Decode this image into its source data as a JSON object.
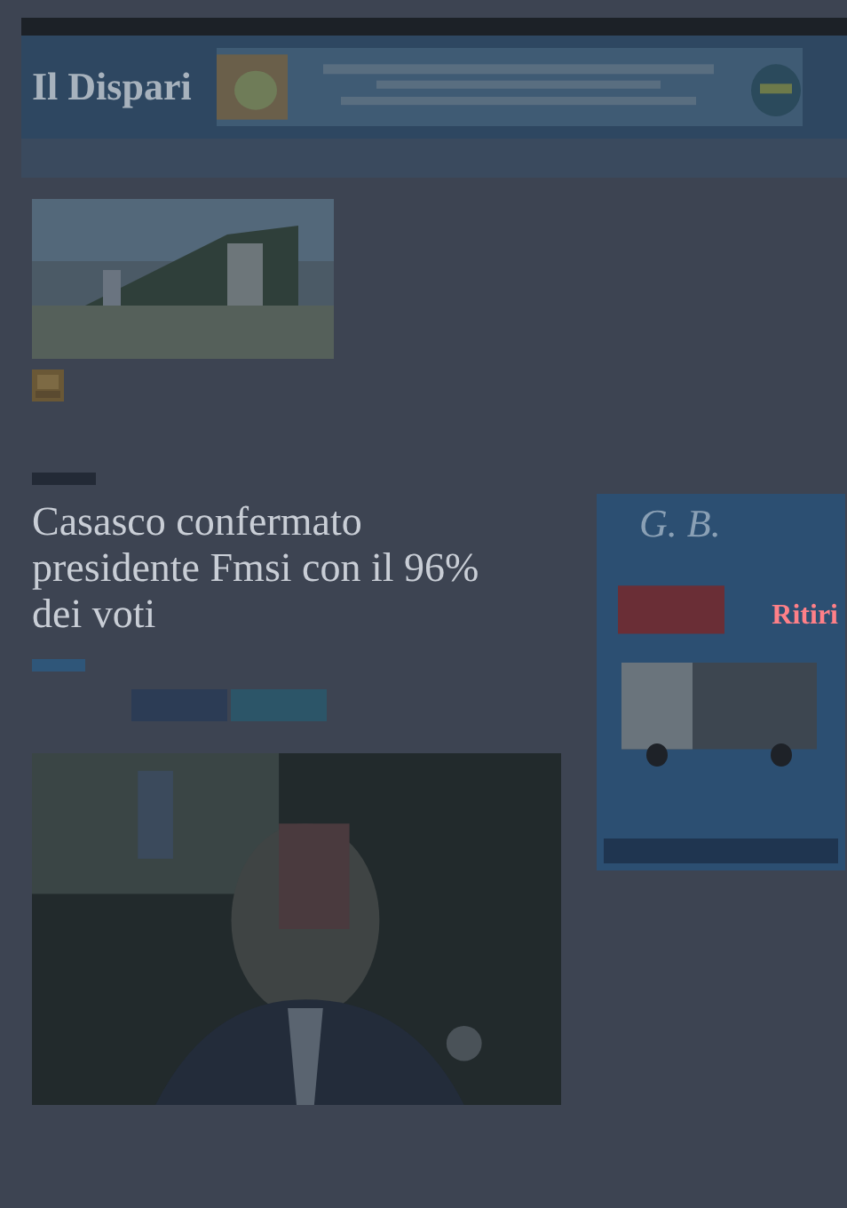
{
  "header": {
    "logo": "Il Dispari"
  },
  "article": {
    "title": "Casasco confermato presidente Fmsi con il 96% dei voti"
  },
  "sidebar_ad": {
    "brand": "G. B.",
    "headline": "Ritiri"
  }
}
